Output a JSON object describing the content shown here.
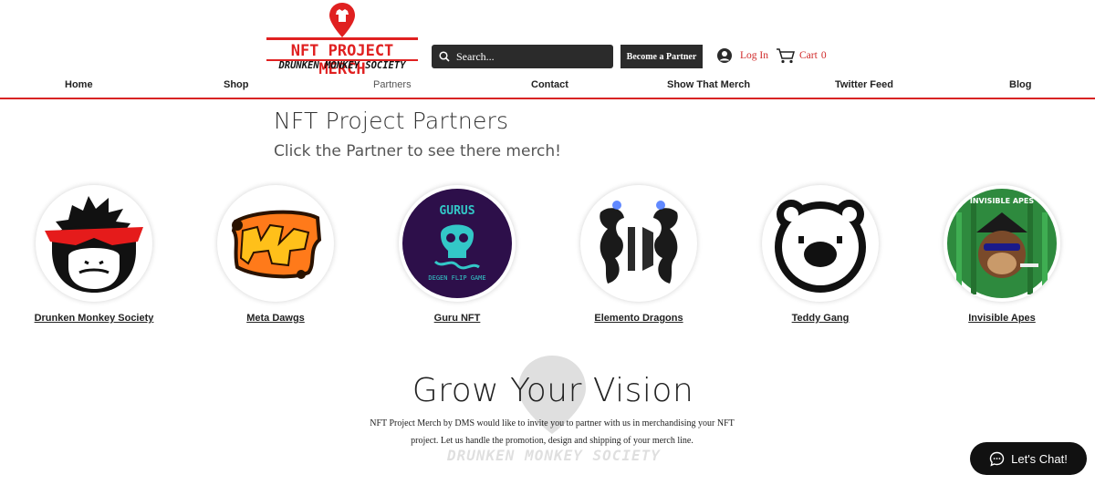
{
  "brand": {
    "title": "NFT PROJECT MERCH",
    "subtitle": "DRUNKEN MONKEY SOCIETY",
    "accent": "#e02020"
  },
  "header": {
    "search_placeholder": "Search...",
    "search_icon": "search-icon",
    "become_partner": "Become a Partner",
    "login": "Log In",
    "login_icon": "user-avatar-icon",
    "cart": "Cart",
    "cart_count": "0",
    "cart_icon": "cart-icon"
  },
  "nav": {
    "items": [
      {
        "label": "Home"
      },
      {
        "label": "Shop"
      },
      {
        "label": "Partners"
      },
      {
        "label": "Contact"
      },
      {
        "label": "Show That Merch"
      },
      {
        "label": "Twitter Feed"
      },
      {
        "label": "Blog"
      }
    ],
    "active": "Partners"
  },
  "main": {
    "heading": "NFT Project Partners",
    "subheading": "Click the Partner to see there merch!",
    "partners": [
      {
        "name": "Drunken Monkey Society"
      },
      {
        "name": "Meta Dawgs"
      },
      {
        "name": "Guru NFT",
        "logo_text": "GURUS",
        "logo_sub": "DEGEN FLIP GAME"
      },
      {
        "name": "Elemento Dragons"
      },
      {
        "name": "Teddy Gang"
      },
      {
        "name": "Invisible Apes",
        "logo_text": "INVISIBLE APES"
      }
    ]
  },
  "vision": {
    "heading": "Grow Your Vision",
    "body": "NFT Project Merch by DMS would like to invite you to partner with us in merchandising your NFT project. Let us handle the promotion, design and shipping of your merch line.",
    "watermark_text": "DRUNKEN MONKEY SOCIETY"
  },
  "chat": {
    "label": "Let's Chat!",
    "icon": "chat-bubble-icon"
  }
}
